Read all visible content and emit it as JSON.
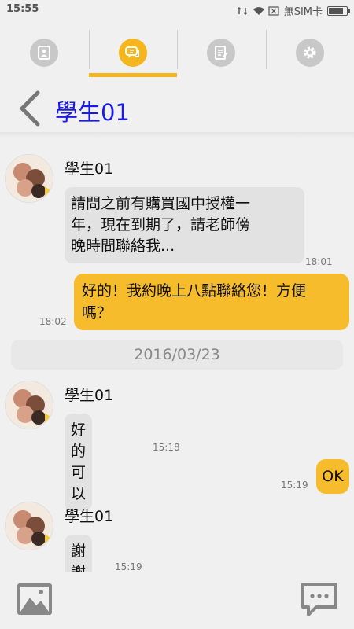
{
  "status_bar": {
    "time": "15:55",
    "carrier": "無SIM卡",
    "battery_level": 0.85
  },
  "tabs": [
    {
      "name": "contacts",
      "icon": "contact-card-icon",
      "active": false
    },
    {
      "name": "chat",
      "icon": "chat-bubbles-icon",
      "active": true
    },
    {
      "name": "notes",
      "icon": "notes-icon",
      "active": false
    },
    {
      "name": "settings",
      "icon": "gear-icon",
      "active": false
    }
  ],
  "header": {
    "title": "學生01"
  },
  "messages": {
    "m1": {
      "sender": "學生01",
      "lines": [
        "請問之前有購買國中授權一",
        "年，現在到期了，請老師傍",
        "晚時間聯絡我..."
      ],
      "time": "18:01"
    },
    "m2": {
      "lines": [
        "好的！我約晚上八點聯絡您！方便",
        "嗎？"
      ],
      "time": "18:02"
    },
    "date": "2016/03/23",
    "m3": {
      "sender": "學生01",
      "text": "好的 可以",
      "time": "15:18"
    },
    "m4": {
      "text": "OK",
      "time": "15:19"
    },
    "m5": {
      "sender": "學生01",
      "text": "謝謝",
      "time": "15:19"
    }
  },
  "colors": {
    "accent": "#f5b51c",
    "title": "#1a1ae8",
    "bubble_in": "#e2e2e2",
    "bubble_out": "#f7bc2c"
  }
}
